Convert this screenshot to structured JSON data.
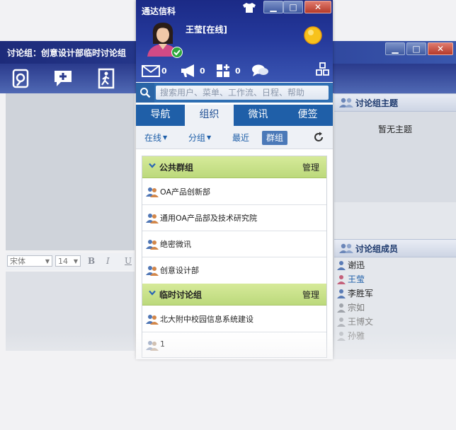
{
  "background_window": {
    "title": "讨论组：创意设计部临时讨论组",
    "font_family_value": "宋体",
    "font_size_value": "14",
    "bold_label": "B",
    "italic_label": "I",
    "underline_label": "U"
  },
  "right_panel": {
    "topic_header": "讨论组主题",
    "no_topic_text": "暂无主题",
    "members_header": "讨论组成员",
    "members": [
      {
        "name": "谢迅",
        "online": true,
        "gender": "male"
      },
      {
        "name": "王莹",
        "online": true,
        "gender": "female"
      },
      {
        "name": "李胜军",
        "online": true,
        "gender": "male"
      },
      {
        "name": "宗如",
        "online": false,
        "gender": "male"
      },
      {
        "name": "王博文",
        "online": false,
        "gender": "male"
      },
      {
        "name": "孙雅",
        "online": false,
        "gender": "male"
      }
    ]
  },
  "main_panel": {
    "app_title": "通达信科",
    "user_display": "王莹[在线]",
    "stats": {
      "mail": "0",
      "notice": "0",
      "apps": "0"
    },
    "search_placeholder": "搜索用户、菜单、工作流、日程、帮助",
    "tabs": [
      "导航",
      "组织",
      "微讯",
      "便签"
    ],
    "active_tab": 1,
    "sub_tabs": [
      "在线",
      "分组",
      "最近",
      "群组"
    ],
    "active_sub_tab": 3,
    "sections": [
      {
        "title": "公共群组",
        "manage_label": "管理",
        "items": [
          "OA产品创新部",
          "通用OA产品部及技术研究院",
          "绝密微讯",
          "创意设计部"
        ]
      },
      {
        "title": "临时讨论组",
        "manage_label": "管理",
        "items": [
          "北大附中校园信息系统建设",
          "1"
        ]
      }
    ]
  },
  "colors": {
    "header_blue": "#24389a",
    "tab_blue": "#1f5fa8",
    "section_green": "#c6e08a",
    "link_blue": "#1d5ea8"
  }
}
